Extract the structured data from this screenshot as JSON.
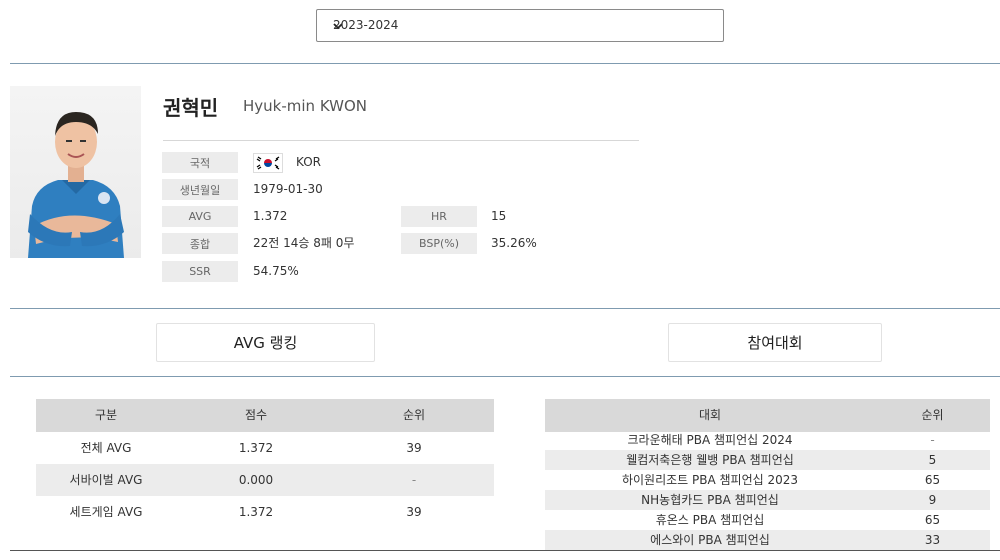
{
  "season": {
    "selected": "2023-2024"
  },
  "player": {
    "name_kr": "권혁민",
    "name_en": "Hyuk-min KWON",
    "fields": [
      {
        "label": "국적",
        "value": "KOR"
      },
      {
        "label": "생년월일",
        "value": "1979-01-30"
      },
      {
        "label": "AVG",
        "value": "1.372"
      },
      {
        "label": "종합",
        "value": "22전 14승 8패 0무"
      },
      {
        "label": "SSR",
        "value": "54.75%"
      },
      {
        "label": "HR",
        "value": "15"
      },
      {
        "label": "BSP(%)",
        "value": "35.26%"
      }
    ]
  },
  "buttons": {
    "avg_ranking": "AVG 랭킹",
    "tournaments": "참여대회"
  },
  "avg_table": {
    "headers": [
      "구분",
      "점수",
      "순위"
    ],
    "rows": [
      [
        "전체 AVG",
        "1.372",
        "39"
      ],
      [
        "서바이벌 AVG",
        "0.000",
        "-"
      ],
      [
        "세트게임 AVG",
        "1.372",
        "39"
      ]
    ]
  },
  "tournament_table": {
    "headers": [
      "대회",
      "순위"
    ],
    "rows": [
      [
        "크라운해태 PBA 챔피언십 2024",
        "-"
      ],
      [
        "웰컴저축은행 웰뱅 PBA 챔피언십",
        "5"
      ],
      [
        "하이원리조트 PBA 챔피언십 2023",
        "65"
      ],
      [
        "NH농협카드 PBA 챔피언십",
        "9"
      ],
      [
        "휴온스 PBA 챔피언십",
        "65"
      ],
      [
        "에스와이 PBA 챔피언십",
        "33"
      ]
    ]
  },
  "colors": {
    "rule": "#7f9bb0",
    "table_header": "#d9d9d9",
    "row_alt": "#ececec",
    "label_bg": "#ececec"
  }
}
